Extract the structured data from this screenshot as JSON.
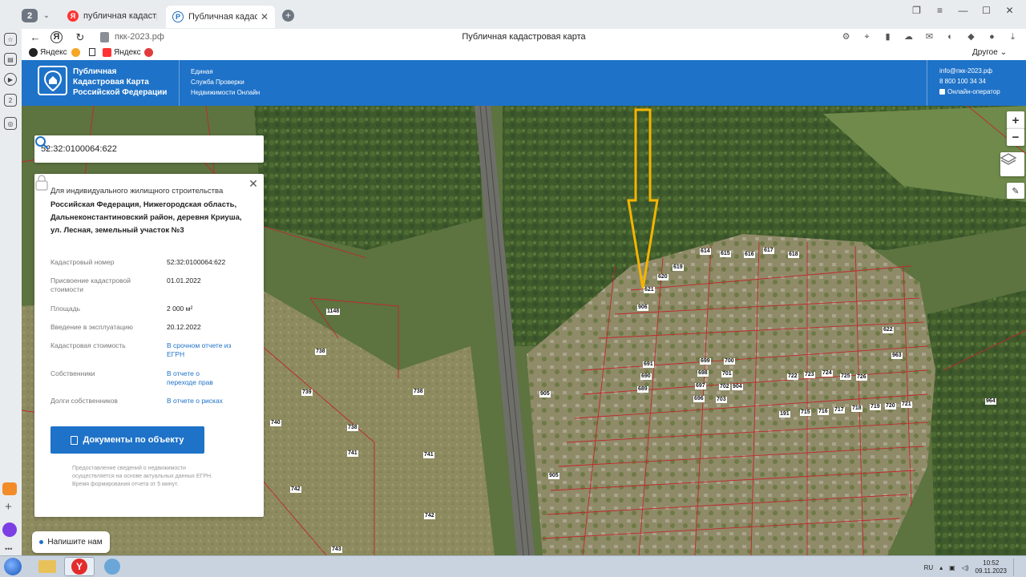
{
  "browser": {
    "tab_count": "2",
    "tabs": [
      {
        "title": "публичная кадастровая к",
        "favicon": "Я"
      },
      {
        "title": "Публичная кадастровая",
        "favicon": "P"
      }
    ],
    "url": "пкк-2023.рф",
    "page_title": "Публичная кадастровая карта",
    "bookmarks": [
      {
        "label": "Яндекс"
      },
      {
        "label": "Яндекс"
      }
    ],
    "bookmarks_more": "Другое"
  },
  "header": {
    "logo_title": "Публичная\nКадастровая Карта\nРоссийской Федерации",
    "service": "Единая\nСлужба Проверки\nНедвижимости Онлайн",
    "email": "info@пкк-2023.рф",
    "phone": "8 800 100 34 34",
    "operator": "Онлайн-оператор"
  },
  "search": {
    "value": "52:32:0100064:622"
  },
  "card": {
    "purpose": "Для индивидуального жилищного строительства",
    "address": "Российская Федерация, Нижегородская область, Дальнеконстантиновский район, деревня Криуша, ул. Лесная, земельный участок №3",
    "rows": [
      {
        "label": "Кадастровый номер",
        "value": "52:32:0100064:622",
        "link": false
      },
      {
        "label": "Присвоение кадастровой стоимости",
        "value": "01.01.2022",
        "link": false
      },
      {
        "label": "Площадь",
        "value": "2 000 м²",
        "link": false
      },
      {
        "label": "Введение в эксплуатацию",
        "value": "20.12.2022",
        "link": false
      },
      {
        "label": "Кадастровая стоимость",
        "value": "В срочном отчете из ЕГРН",
        "link": true
      },
      {
        "label": "Собственники",
        "value": "В отчете о переходе прав",
        "link": true
      },
      {
        "label": "Долги собственников",
        "value": "В отчете о рисках",
        "link": true
      }
    ],
    "docs_button": "Документы по объекту",
    "note": "Предоставление сведений о недвижимости осуществляется на основе актуальных данных ЕГРН. Время формирования отчета от 5 минут."
  },
  "map_controls": {
    "zoom_in": "+",
    "zoom_out": "−"
  },
  "map_labels": [
    "738",
    "739",
    "740",
    "738",
    "741",
    "741",
    "742",
    "742",
    "743",
    "738",
    "1148",
    "905",
    "905",
    "904",
    "691",
    "690",
    "689",
    "699",
    "698",
    "697",
    "696",
    "700",
    "701",
    "702",
    "703",
    "906",
    "614",
    "615",
    "616",
    "617",
    "618",
    "619",
    "620",
    "621",
    "622",
    "963",
    "964",
    "191",
    "715",
    "716",
    "717",
    "718",
    "719",
    "720",
    "721",
    "722",
    "723",
    "724",
    "725",
    "726"
  ],
  "chat_label": "Напишите нам",
  "taskbar": {
    "lang": "RU",
    "time": "10:52",
    "date": "09.11.2023"
  },
  "colors": {
    "brand_blue": "#1e72c8",
    "arrow_yellow": "#f5b400",
    "parcel_red": "#c0282c"
  }
}
